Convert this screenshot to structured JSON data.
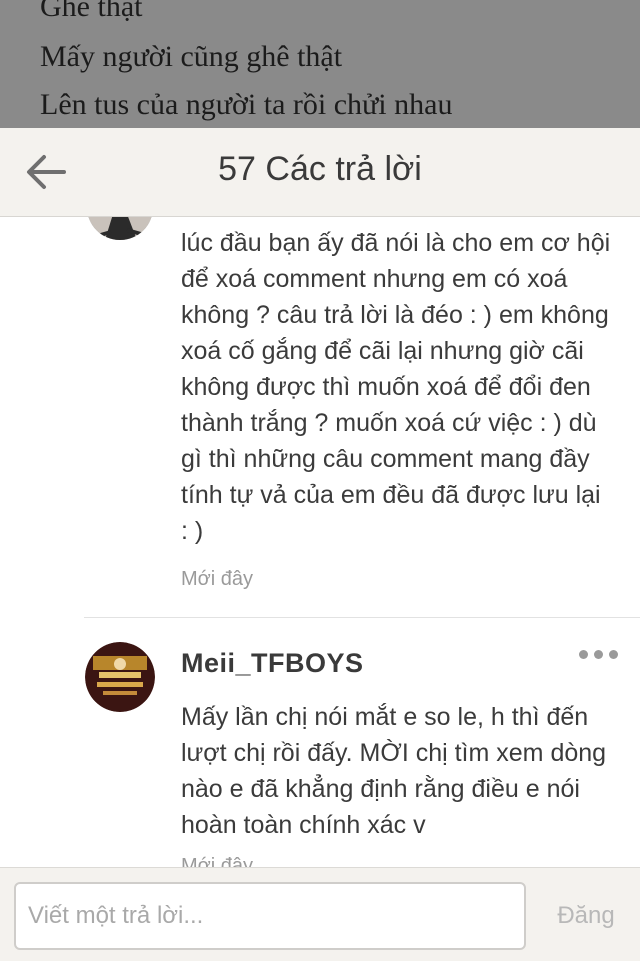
{
  "background_story": {
    "lines": [
      "Ghê thật",
      "Mấy người cũng ghê thật",
      "Lên tus của người ta rồi chửi nhau"
    ]
  },
  "header": {
    "back_icon": "arrow-left-icon",
    "title": "57 Các trả lời"
  },
  "comments": [
    {
      "avatar_icon": "user-avatar",
      "text": "lúc đầu bạn ấy đã nói là cho em cơ hội để xoá comment nhưng em có xoá không ? câu trả lời là đéo : ) em không xoá cố gắng để cãi lại nhưng giờ cãi không được thì muốn xoá để đổi đen thành trắng ? muốn xoá cứ việc : ) dù gì thì những câu comment mang đầy tính tự vả của em đều đã được lưu lại : )",
      "time": "Mới đây"
    },
    {
      "avatar_icon": "user-avatar",
      "username": "Meii_TFBOYS",
      "more_icon": "more-dots-icon",
      "text": "Mấy lần chị nói mắt e so le, h thì đến lượt chị rồi đấy. MỜI chị tìm xem dòng nào e đã khẳng định rằng điều e nói hoàn toàn chính xác v",
      "time": "Mới đây"
    }
  ],
  "footer": {
    "reply_placeholder": "Viết một trả lời...",
    "post_label": "Đăng"
  },
  "colors": {
    "header_bg": "#f4f2ee",
    "dim_bg": "#8a8a8a",
    "text": "#3b3b3b",
    "muted": "#9a9a9a"
  }
}
